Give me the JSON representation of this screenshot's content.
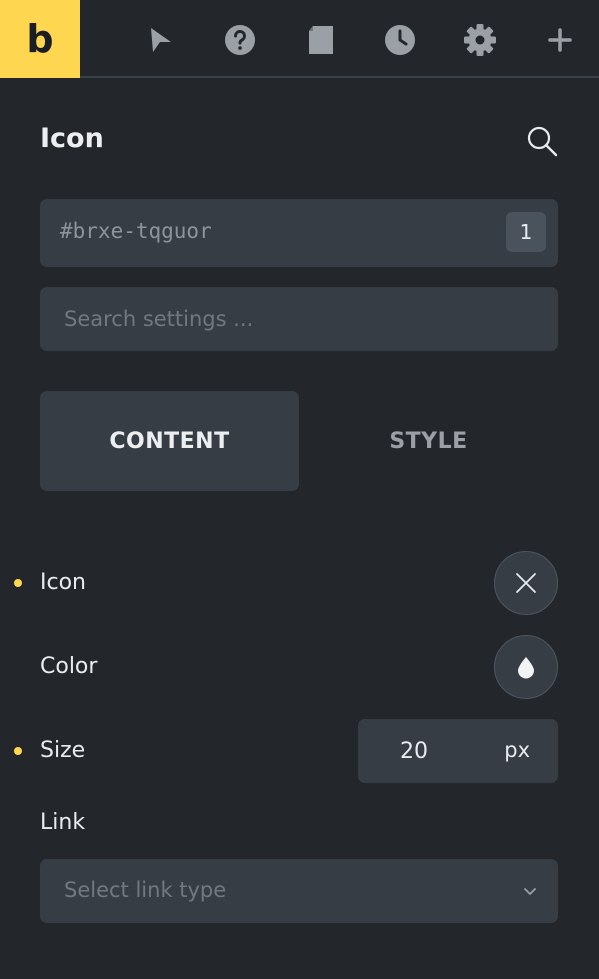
{
  "topbar": {
    "logo_letter": "b",
    "icons": [
      {
        "name": "cursor-icon"
      },
      {
        "name": "help-icon"
      },
      {
        "name": "page-icon"
      },
      {
        "name": "history-icon"
      },
      {
        "name": "settings-icon"
      },
      {
        "name": "add-icon"
      }
    ]
  },
  "colors": {
    "accent": "#ffd64f",
    "background": "#23272c",
    "field": "#363d45",
    "muted_text": "#72787f"
  },
  "panel": {
    "title": "Icon",
    "element_id": "#brxe-tqguor",
    "element_count": "1",
    "search_placeholder": "Search settings ...",
    "tabs": [
      {
        "label": "CONTENT",
        "active": true
      },
      {
        "label": "STYLE",
        "active": false
      }
    ]
  },
  "controls": {
    "icon": {
      "label": "Icon",
      "has_value": true
    },
    "color": {
      "label": "Color",
      "has_value": false
    },
    "size": {
      "label": "Size",
      "value": "20",
      "unit": "px",
      "has_value": true
    },
    "link": {
      "label": "Link",
      "placeholder": "Select link type"
    }
  }
}
